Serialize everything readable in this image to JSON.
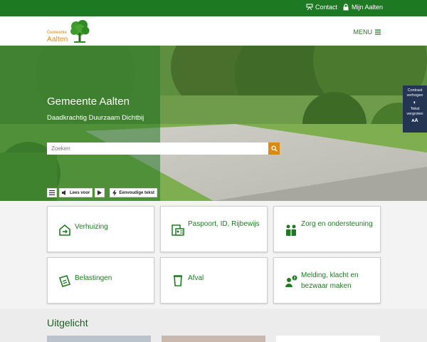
{
  "topbar": {
    "contact": "Contact",
    "mijn": "Mijn Aalten"
  },
  "logo": {
    "small": "Gemeente",
    "big": "Aalten"
  },
  "menu": {
    "label": "MENU"
  },
  "hero": {
    "title": "Gemeente Aalten",
    "subtitle": "Daadkrachtig Duurzaam Dichtbij",
    "search_placeholder": "Zoeken",
    "readspeaker": "Lees voor",
    "simple_text": "Eenvoudige tekst"
  },
  "accessibility": {
    "contrast": "Contrast verhogen",
    "text": "Tekst vergroten",
    "text_icon": "ᴀA"
  },
  "tiles": [
    {
      "label": "Verhuizing",
      "icon": "house-arrow-icon"
    },
    {
      "label": "Paspoort, ID, Rijbewijs",
      "icon": "id-card-icon"
    },
    {
      "label": "Zorg en ondersteuning",
      "icon": "care-icon"
    },
    {
      "label": "Belastingen",
      "icon": "tax-icon"
    },
    {
      "label": "Afval",
      "icon": "trash-bin-icon"
    },
    {
      "label": "Melding, klacht en bezwaar maken",
      "icon": "report-person-icon"
    }
  ],
  "featured": {
    "title": "Uitgelicht"
  },
  "colors": {
    "brand_green": "#1e7a22",
    "orange": "#d98a13",
    "navy": "#243553"
  }
}
